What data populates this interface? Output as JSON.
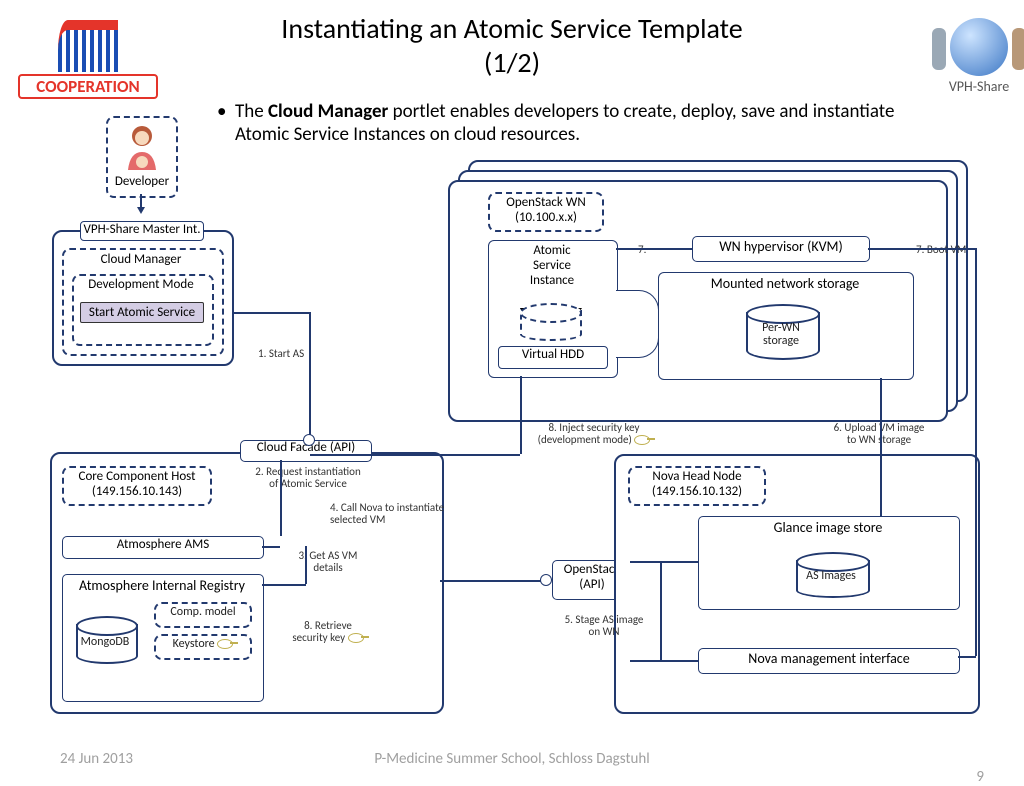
{
  "title_line1": "Instantiating an Atomic Service Template",
  "title_line2": "(1/2)",
  "bullet_pre": "The ",
  "bullet_bold": "Cloud Manager",
  "bullet_post": " portlet enables developers to create, deploy, save and instantiate Atomic Service Instances on cloud resources.",
  "coop": "COOPERATION",
  "vph": "VPH-Share",
  "developer": "Developer",
  "master_int": "VPH-Share Master Int.",
  "cloud_manager": "Cloud Manager",
  "dev_mode": "Development Mode",
  "start_as": "Start Atomic Service",
  "cloud_facade": "Cloud Facade (API)",
  "core_host_l1": "Core Component Host",
  "core_host_l2": "(149.156.10.143)",
  "atmo_ams": "Atmosphere AMS",
  "atmo_reg": "Atmosphere Internal Registry",
  "mongodb": "MongoDB",
  "comp_model": "Comp. model",
  "keystore": "Keystore",
  "openstack_api": "OpenStack (API)",
  "nova_head_l1": "Nova Head Node",
  "nova_head_l2": "(149.156.10.132)",
  "glance": "Glance image store",
  "as_images": "AS Images",
  "nova_mgmt": "Nova management interface",
  "openstack_wn_l1": "OpenStack WN",
  "openstack_wn_l2": "(10.100.x.x)",
  "asi_l1": "Atomic",
  "asi_l2": "Service",
  "asi_l3": "Instance",
  "virtual_hdd": "Virtual HDD",
  "wn_hyper": "WN hypervisor (KVM)",
  "mounted": "Mounted network storage",
  "perwn_l1": "Per-WN",
  "perwn_l2": "storage",
  "step1": "1. Start AS",
  "step2_l1": "2. Request instantiation",
  "step2_l2": "of Atomic Service",
  "step3_l1": "3. Get AS VM",
  "step3_l2": "details",
  "step4_l1": "4. Call Nova to instantiate",
  "step4_l2": "selected VM",
  "step5_l1": "5. Stage AS image",
  "step5_l2": "on WN",
  "step6_l1": "6. Upload VM image",
  "step6_l2": "to WN storage",
  "step7": "7.",
  "step7_boot": "7. Boot VM",
  "step8a_l1": "8. Retrieve",
  "step8a_l2": "security key",
  "step8b_l1": "8. Inject security key",
  "step8b_l2": "(development mode)",
  "footer_date": "24 Jun 2013",
  "footer_venue": "P-Medicine Summer School, Schloss Dagstuhl",
  "footer_page": "9"
}
